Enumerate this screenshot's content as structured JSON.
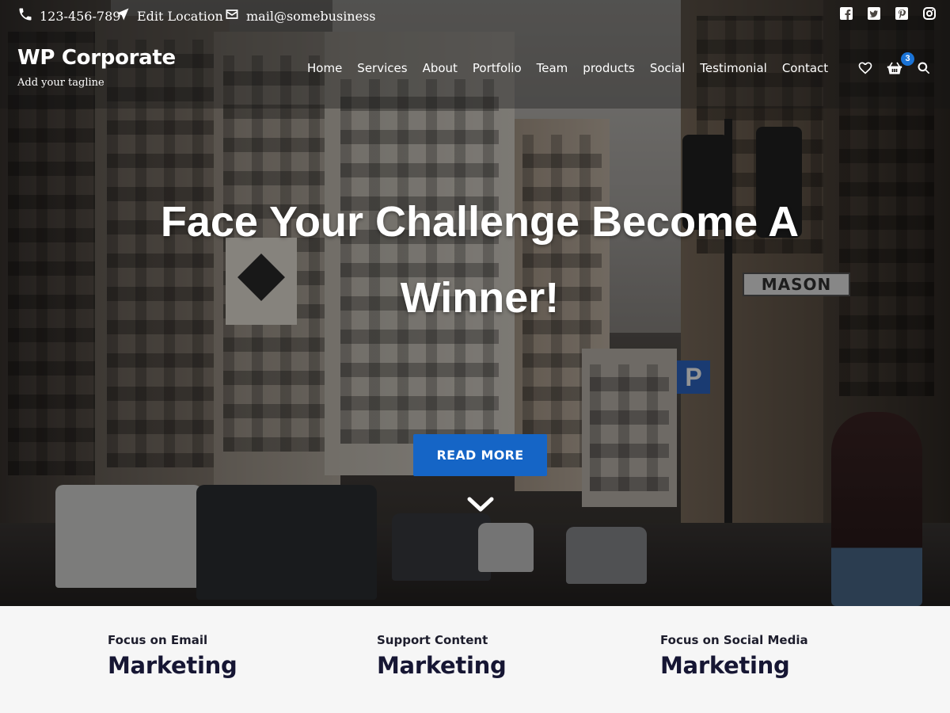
{
  "topbar": {
    "phone": "123-456-789",
    "location": "Edit Location",
    "email": "mail@somebusiness"
  },
  "social_icons": [
    "facebook-icon",
    "twitter-icon",
    "pinterest-icon",
    "instagram-icon"
  ],
  "site": {
    "title": "WP Corporate",
    "tagline": "Add your tagline"
  },
  "nav": {
    "items": [
      "Home",
      "Services",
      "About",
      "Portfolio",
      "Team",
      "products",
      "Social",
      "Testimonial",
      "Contact"
    ],
    "cart_count": "3"
  },
  "hero": {
    "title_line1": "Face Your Challenge Become A",
    "title_line2": "Winner!",
    "button_label": "READ MORE",
    "sign_mason": "MASON",
    "sign_parking": "P"
  },
  "features": [
    {
      "subtitle": "Focus on Email",
      "title": "Marketing"
    },
    {
      "subtitle": "Support Content",
      "title": "Marketing"
    },
    {
      "subtitle": "Focus on Social Media",
      "title": "Marketing"
    }
  ],
  "colors": {
    "accent": "#1565c6",
    "badge": "#1a73d6",
    "feature_text": "#161633"
  }
}
